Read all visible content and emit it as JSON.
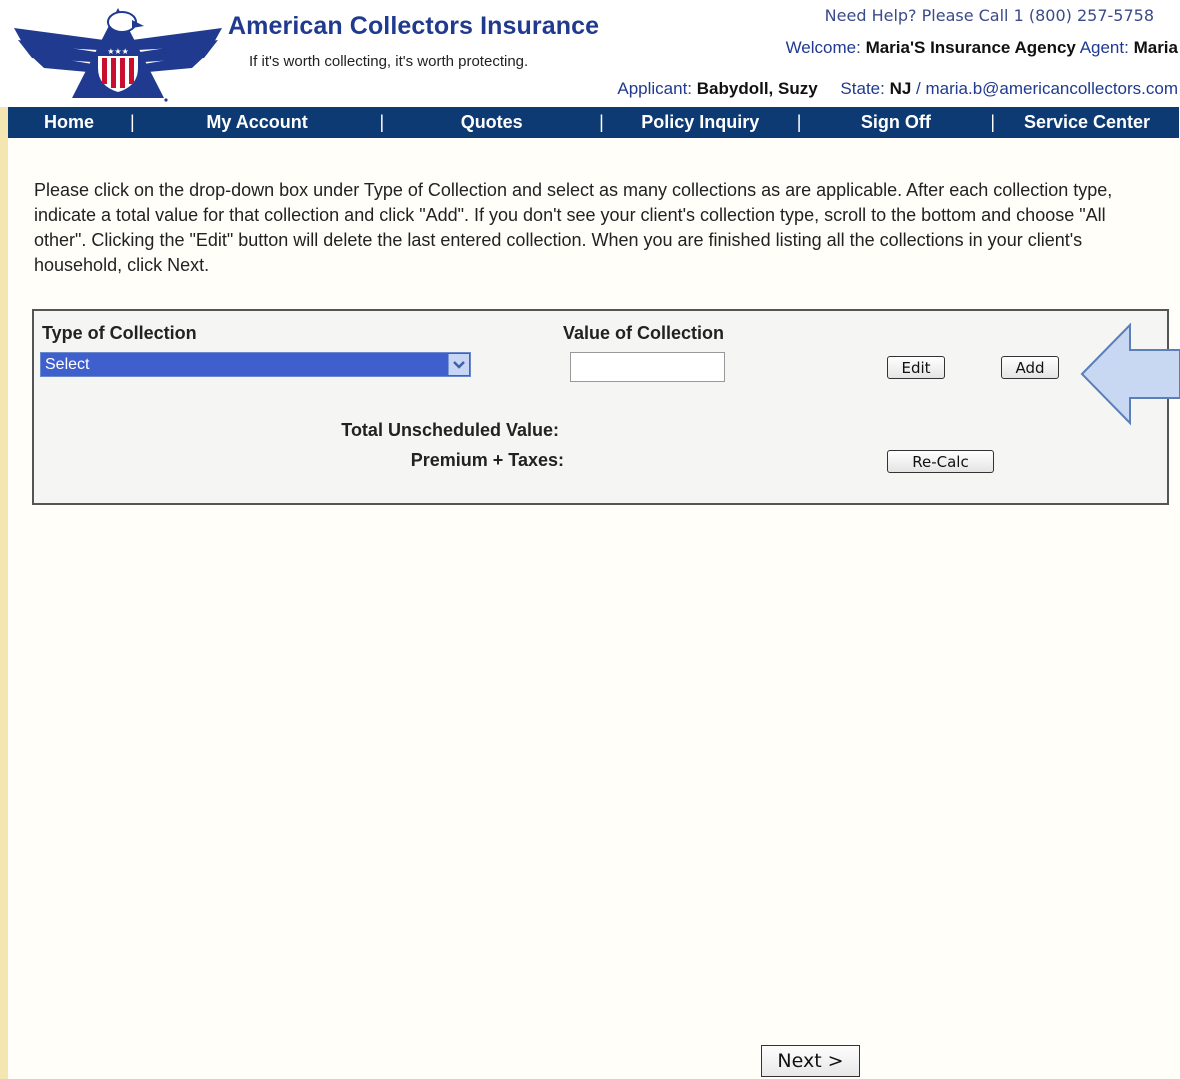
{
  "header": {
    "brand_name": "American Collectors Insurance",
    "tagline": "If it's worth collecting, it's worth protecting.",
    "help_text": "Need Help? Please Call 1 (800) 257-5758",
    "welcome_label": "Welcome:",
    "agency_name": "Maria'S Insurance Agency",
    "agent_label": "Agent:",
    "agent_name": "Maria",
    "applicant_label": "Applicant:",
    "applicant_name": "Babydoll, Suzy",
    "state_label": "State:",
    "state_value": "NJ",
    "email": "/ maria.b@americancollectors.com"
  },
  "nav": {
    "items": [
      "Home",
      "My Account",
      "Quotes",
      "Policy Inquiry",
      "Sign Off",
      "Service Center"
    ],
    "separator": "|"
  },
  "instructions": "Please click on the drop-down box under Type of Collection and select as many collections as are applicable. After each collection type, indicate a total value for that collection and click \"Add\". If you don't see your client's collection type, scroll to the bottom and choose \"All other\". Clicking the \"Edit\" button will delete the last entered collection. When you are finished listing all the collections in your client's household, click Next.",
  "form": {
    "type_header": "Type of Collection",
    "value_header": "Value of Collection",
    "select_value": "Select",
    "value_input": "",
    "edit_label": "Edit",
    "add_label": "Add",
    "total_label": "Total Unscheduled Value:",
    "premium_label": "Premium + Taxes:",
    "recalc_label": "Re-Calc"
  },
  "next_label": "Next >",
  "colors": {
    "brand_blue": "#1f3a8f",
    "nav_bg": "#0d3a73",
    "select_bg": "#3f5fcc",
    "callout_arrow": "#c9d8f2"
  },
  "icons": {
    "logo": "eagle-shield-logo",
    "callout": "left-arrow-callout",
    "dropdown": "chevron-down-icon"
  }
}
